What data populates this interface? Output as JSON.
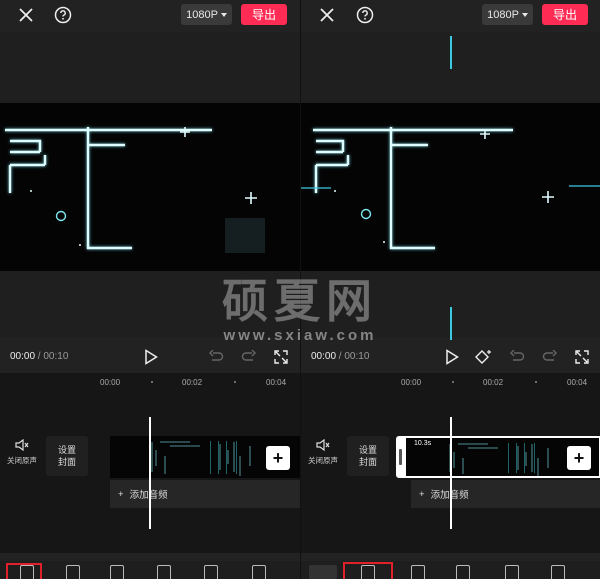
{
  "left": {
    "resolution": "1080P",
    "export_label": "导出",
    "time_current": "00:00",
    "time_sep": " / ",
    "time_total": "00:10",
    "ruler": [
      "00:00",
      "00:02",
      "00:04"
    ],
    "mute_label": "关闭原声",
    "cover_line1": "设置",
    "cover_line2": "封面",
    "add_audio": "添加音频"
  },
  "right": {
    "resolution": "1080P",
    "export_label": "导出",
    "time_current": "00:00",
    "time_sep": " / ",
    "time_total": "00:10",
    "ruler": [
      "00:00",
      "00:02",
      "00:04"
    ],
    "mute_label": "关闭原声",
    "cover_line1": "设置",
    "cover_line2": "封面",
    "clip_duration": "10.3s",
    "add_audio": "添加音频"
  },
  "watermark": {
    "text": "硕夏网",
    "url": "www.sxiaw.com"
  },
  "colors": {
    "accent": "#fe2c55",
    "highlight": "#e0202b",
    "neon": "#7ee7f0"
  }
}
